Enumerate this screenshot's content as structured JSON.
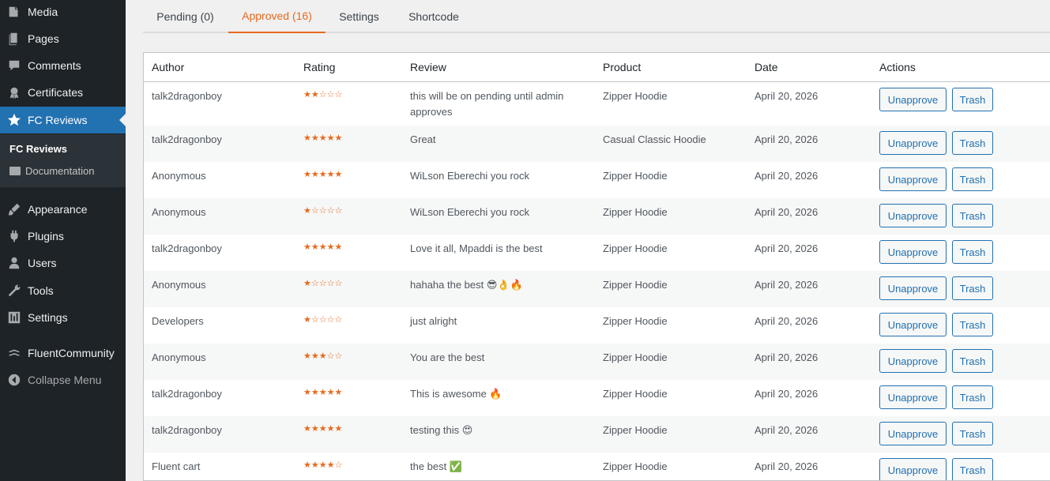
{
  "sidebar": {
    "items": [
      {
        "label": "Media",
        "icon": "media-icon"
      },
      {
        "label": "Pages",
        "icon": "pages-icon"
      },
      {
        "label": "Comments",
        "icon": "comments-icon"
      },
      {
        "label": "Certificates",
        "icon": "certificate-icon"
      },
      {
        "label": "FC Reviews",
        "icon": "star-icon"
      },
      {
        "label": "Appearance",
        "icon": "paintbrush-icon"
      },
      {
        "label": "Plugins",
        "icon": "plugin-icon"
      },
      {
        "label": "Users",
        "icon": "users-icon"
      },
      {
        "label": "Tools",
        "icon": "wrench-icon"
      },
      {
        "label": "Settings",
        "icon": "settings-icon"
      },
      {
        "label": "FluentCommunity",
        "icon": "fluent-icon"
      },
      {
        "label": "Collapse Menu",
        "icon": "collapse-icon"
      }
    ],
    "submenu": {
      "current": "FC Reviews",
      "documentation": "Documentation"
    }
  },
  "tabs": [
    {
      "label": "Pending (0)"
    },
    {
      "label": "Approved (16)"
    },
    {
      "label": "Settings"
    },
    {
      "label": "Shortcode"
    }
  ],
  "table": {
    "headers": {
      "author": "Author",
      "rating": "Rating",
      "review": "Review",
      "product": "Product",
      "date": "Date",
      "actions": "Actions"
    },
    "buttons": {
      "unapprove": "Unapprove",
      "trash": "Trash"
    },
    "rows": [
      {
        "author": "talk2dragonboy",
        "rating": 2,
        "review": "this will be on pending until admin",
        "review2": "approves",
        "product": "Zipper Hoodie",
        "date": "April 20, 2026"
      },
      {
        "author": "talk2dragonboy",
        "rating": 5,
        "review": "Great",
        "review2": "",
        "product": "Casual Classic Hoodie",
        "date": "April 20, 2026"
      },
      {
        "author": "Anonymous",
        "rating": 5,
        "review": "WiLson Eberechi you rock",
        "review2": "",
        "product": "Zipper Hoodie",
        "date": "April 20, 2026"
      },
      {
        "author": "Anonymous",
        "rating": 1,
        "review": "WiLson Eberechi you rock",
        "review2": "",
        "product": "Zipper Hoodie",
        "date": "April 20, 2026"
      },
      {
        "author": "talk2dragonboy",
        "rating": 5,
        "review": "Love it all, Mpaddi is the best",
        "review2": "",
        "product": "Zipper Hoodie",
        "date": "April 20, 2026"
      },
      {
        "author": "Anonymous",
        "rating": 1,
        "review": "hahaha the best 😎👌🔥",
        "review2": "",
        "product": "Zipper Hoodie",
        "date": "April 20, 2026"
      },
      {
        "author": "Developers",
        "rating": 1,
        "review": "just alright",
        "review2": "",
        "product": "Zipper Hoodie",
        "date": "April 20, 2026"
      },
      {
        "author": "Anonymous",
        "rating": 3,
        "review": "You are the best",
        "review2": "",
        "product": "Zipper Hoodie",
        "date": "April 20, 2026"
      },
      {
        "author": "talk2dragonboy",
        "rating": 5,
        "review": "This is awesome 🔥",
        "review2": "",
        "product": "Zipper Hoodie",
        "date": "April 20, 2026"
      },
      {
        "author": "talk2dragonboy",
        "rating": 5,
        "review": "testing this 😍",
        "review2": "",
        "product": "Zipper Hoodie",
        "date": "April 20, 2026"
      },
      {
        "author": "Fluent cart",
        "rating": 4,
        "review": "the best ✅",
        "review2": "",
        "product": "Zipper Hoodie",
        "date": "April 20, 2026"
      }
    ]
  },
  "colors": {
    "accent": "#e66a1e",
    "wp_blue": "#2271b1",
    "sidebar_bg": "#1d2327"
  }
}
